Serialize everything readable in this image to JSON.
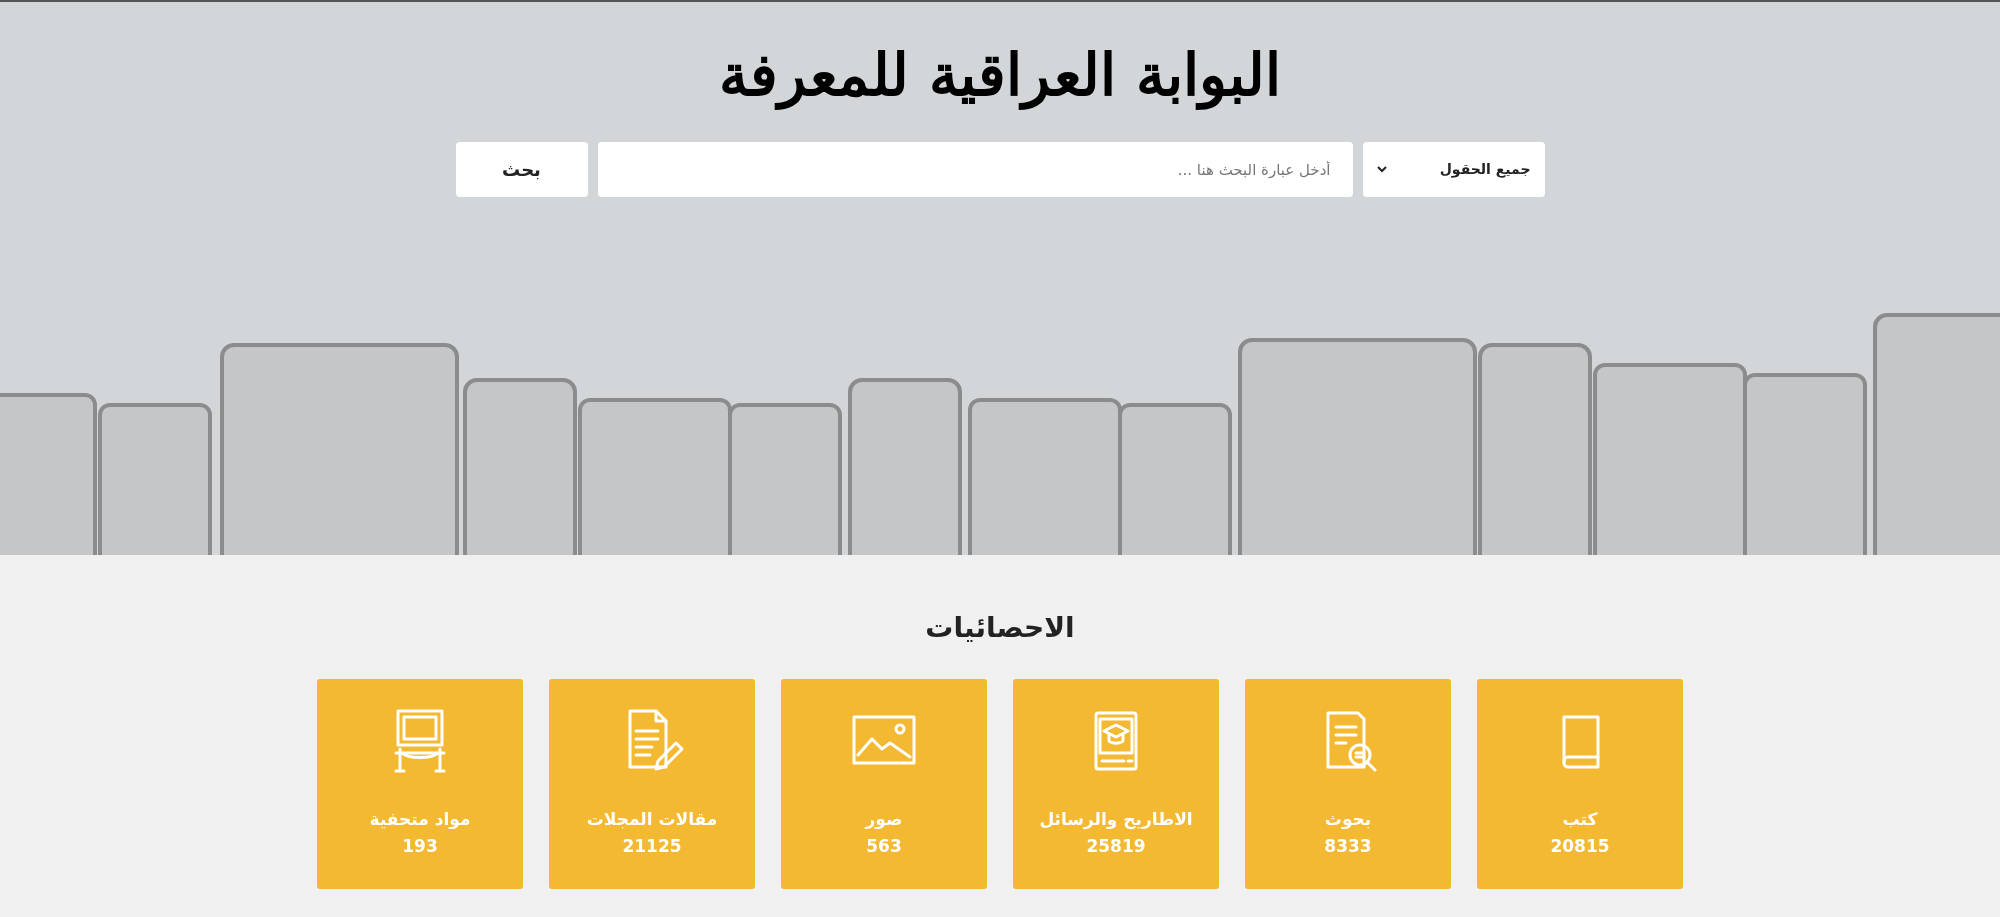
{
  "header": {
    "logo_text": "البوابة العراقية للمعرفة"
  },
  "search": {
    "scope": "جميع الحقول",
    "placeholder": "أدخل عبارة البحث هنا ...",
    "button": "بحث"
  },
  "statistics": {
    "title": "الاحصائيات",
    "items": [
      {
        "kind": "books",
        "label": "كتب",
        "count": "20815"
      },
      {
        "kind": "research",
        "label": "بحوث",
        "count": "8333"
      },
      {
        "kind": "theses",
        "label": "الاطاريح والرسائل",
        "count": "25819"
      },
      {
        "kind": "images",
        "label": "صور",
        "count": "563"
      },
      {
        "kind": "articles",
        "label": "مقالات المجلات",
        "count": "21125"
      },
      {
        "kind": "museum",
        "label": "مواد متحفية",
        "count": "193"
      }
    ]
  }
}
